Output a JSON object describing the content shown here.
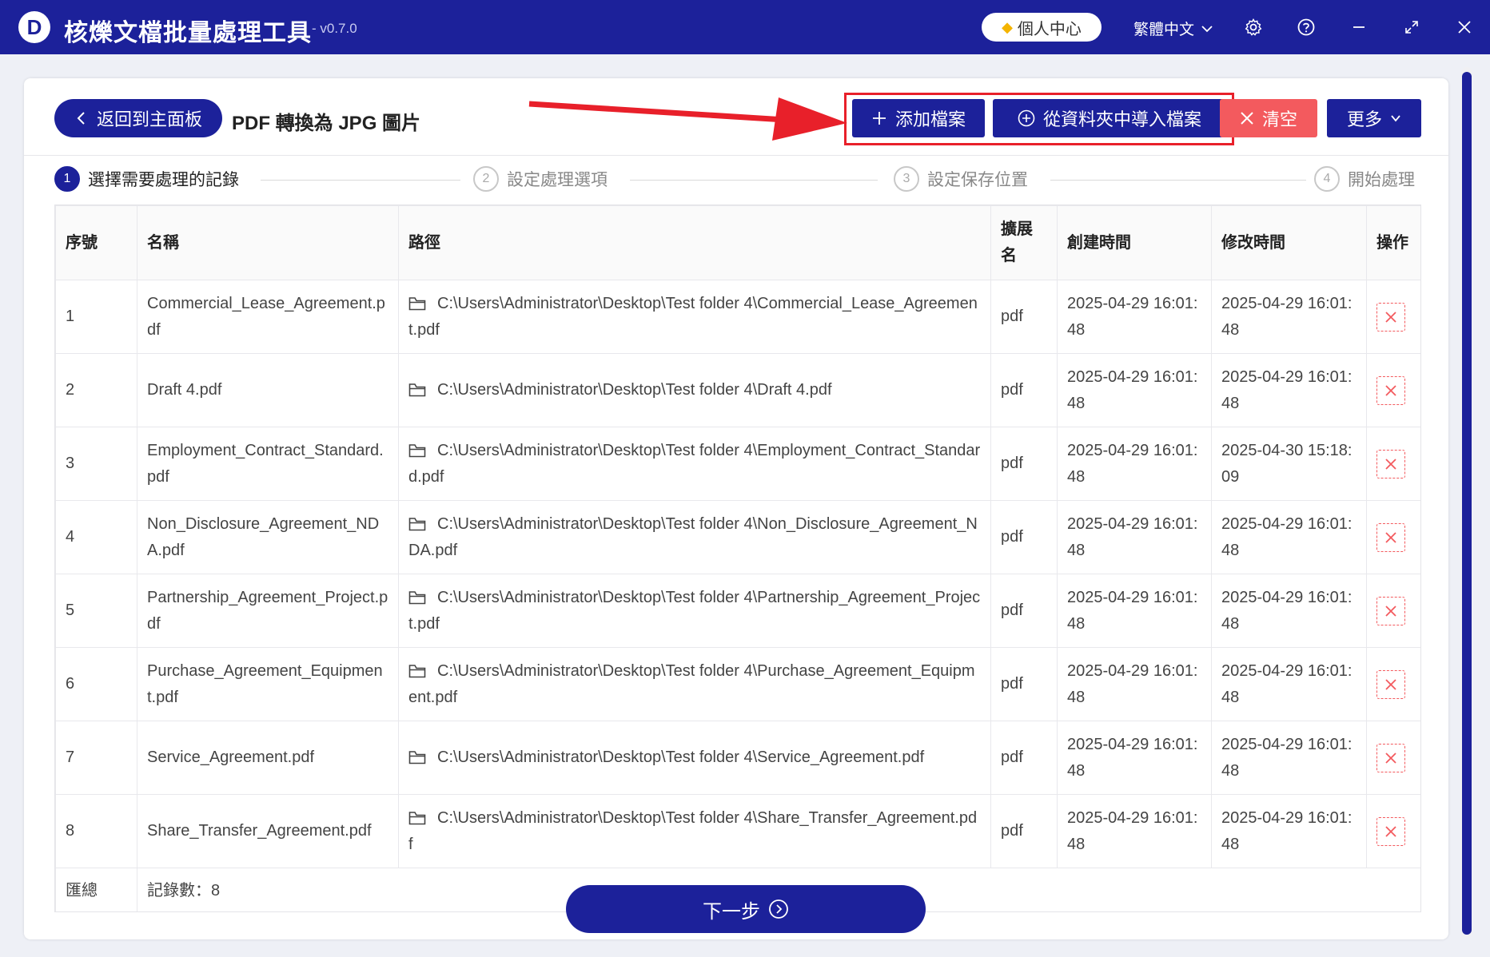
{
  "app": {
    "logo_letter": "D",
    "title": "核爍文檔批量處理工具",
    "version": "- v0.7.0",
    "user_center": "個人中心",
    "language": "繁體中文"
  },
  "toolbar": {
    "back_label": "返回到主面板",
    "page_title": "PDF 轉換為 JPG 圖片",
    "add_label": "添加檔案",
    "import_label": "從資料夾中導入檔案",
    "clear_label": "清空",
    "more_label": "更多"
  },
  "steps": [
    {
      "num": "1",
      "label": "選擇需要處理的記錄"
    },
    {
      "num": "2",
      "label": "設定處理選項"
    },
    {
      "num": "3",
      "label": "設定保存位置"
    },
    {
      "num": "4",
      "label": "開始處理"
    }
  ],
  "table": {
    "headers": [
      "序號",
      "名稱",
      "路徑",
      "擴展名",
      "創建時間",
      "修改時間",
      "操作"
    ],
    "rows": [
      {
        "index": "1",
        "name": "Commercial_Lease_Agreement.pdf",
        "path": "C:\\Users\\Administrator\\Desktop\\Test folder 4\\Commercial_Lease_Agreement.pdf",
        "ext": "pdf",
        "created": "2025-04-29 16:01:48",
        "modified": "2025-04-29 16:01:48"
      },
      {
        "index": "2",
        "name": "Draft 4.pdf",
        "path": "C:\\Users\\Administrator\\Desktop\\Test folder 4\\Draft 4.pdf",
        "ext": "pdf",
        "created": "2025-04-29 16:01:48",
        "modified": "2025-04-29 16:01:48"
      },
      {
        "index": "3",
        "name": "Employment_Contract_Standard.pdf",
        "path": "C:\\Users\\Administrator\\Desktop\\Test folder 4\\Employment_Contract_Standard.pdf",
        "ext": "pdf",
        "created": "2025-04-29 16:01:48",
        "modified": "2025-04-30 15:18:09"
      },
      {
        "index": "4",
        "name": "Non_Disclosure_Agreement_NDA.pdf",
        "path": "C:\\Users\\Administrator\\Desktop\\Test folder 4\\Non_Disclosure_Agreement_NDA.pdf",
        "ext": "pdf",
        "created": "2025-04-29 16:01:48",
        "modified": "2025-04-29 16:01:48"
      },
      {
        "index": "5",
        "name": "Partnership_Agreement_Project.pdf",
        "path": "C:\\Users\\Administrator\\Desktop\\Test folder 4\\Partnership_Agreement_Project.pdf",
        "ext": "pdf",
        "created": "2025-04-29 16:01:48",
        "modified": "2025-04-29 16:01:48"
      },
      {
        "index": "6",
        "name": "Purchase_Agreement_Equipment.pdf",
        "path": "C:\\Users\\Administrator\\Desktop\\Test folder 4\\Purchase_Agreement_Equipment.pdf",
        "ext": "pdf",
        "created": "2025-04-29 16:01:48",
        "modified": "2025-04-29 16:01:48"
      },
      {
        "index": "7",
        "name": "Service_Agreement.pdf",
        "path": "C:\\Users\\Administrator\\Desktop\\Test folder 4\\Service_Agreement.pdf",
        "ext": "pdf",
        "created": "2025-04-29 16:01:48",
        "modified": "2025-04-29 16:01:48"
      },
      {
        "index": "8",
        "name": "Share_Transfer_Agreement.pdf",
        "path": "C:\\Users\\Administrator\\Desktop\\Test folder 4\\Share_Transfer_Agreement.pdf",
        "ext": "pdf",
        "created": "2025-04-29 16:01:48",
        "modified": "2025-04-29 16:01:48"
      }
    ],
    "summary_label": "匯總",
    "summary_count": "記錄數：8"
  },
  "footer": {
    "next_label": "下一步"
  },
  "colors": {
    "primary": "#1c219a",
    "danger": "#f35a5e",
    "highlight": "#e8202a"
  },
  "icons": [
    "chevron-left-icon",
    "plus-icon",
    "circle-plus-icon",
    "close-icon",
    "chevron-down-icon",
    "folder-icon",
    "gear-icon",
    "help-icon",
    "minimize-icon",
    "maximize-icon",
    "diamond-icon",
    "arrow-right-circle-icon"
  ]
}
